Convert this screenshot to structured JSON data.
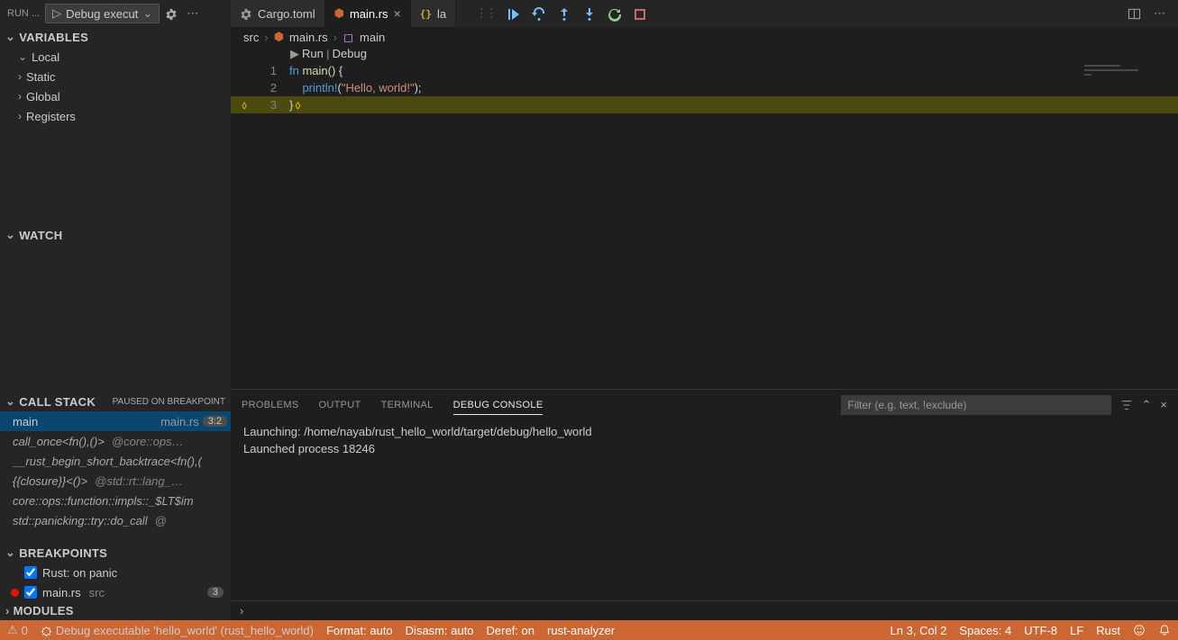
{
  "runbar": {
    "label": "RUN ...",
    "config": "Debug execut"
  },
  "tabs": [
    {
      "label": "Cargo.toml",
      "icon": "gear"
    },
    {
      "label": "main.rs",
      "icon": "rust",
      "active": true
    },
    {
      "label": "la",
      "icon": "json"
    }
  ],
  "crumbs": {
    "c0": "src",
    "c1": "main.rs",
    "c2": "main"
  },
  "codelens": {
    "run": "Run",
    "debug": "Debug"
  },
  "code": {
    "l1": {
      "num": "1",
      "kw": "fn ",
      "fn": "main",
      "rest": "() {"
    },
    "l2": {
      "num": "2",
      "m": "println!",
      "p1": "(",
      "s": "\"Hello, world!\"",
      "p2": ");"
    },
    "l3": {
      "num": "3",
      "rest": "}"
    }
  },
  "sidebar": {
    "variables": {
      "title": "VARIABLES",
      "items": [
        "Local",
        "Static",
        "Global",
        "Registers"
      ]
    },
    "watch": {
      "title": "WATCH"
    },
    "callstack": {
      "title": "CALL STACK",
      "msg": "PAUSED ON BREAKPOINT",
      "frames": [
        {
          "func": "main",
          "file": "main.rs",
          "badge": "3:2"
        },
        {
          "func": "call_once<fn(),()>",
          "loc": "@core::ops…"
        },
        {
          "func": "__rust_begin_short_backtrace<fn(),(",
          "loc": ""
        },
        {
          "func": "{{closure}}<()>",
          "loc": "@std::rt::lang_…"
        },
        {
          "func": "core::ops::function::impls::_$LT$im",
          "loc": ""
        },
        {
          "func": "std::panicking::try::do_call",
          "loc": "@"
        }
      ]
    },
    "breakpoints": {
      "title": "BREAKPOINTS",
      "items": [
        {
          "label": "Rust: on panic",
          "marker": false
        },
        {
          "label": "main.rs",
          "loc": "src",
          "badge": "3",
          "marker": true
        }
      ]
    },
    "modules": {
      "title": "MODULES"
    }
  },
  "panel": {
    "tabs": {
      "problems": "PROBLEMS",
      "output": "OUTPUT",
      "terminal": "TERMINAL",
      "debug": "DEBUG CONSOLE"
    },
    "filter_ph": "Filter (e.g. text, !exclude)",
    "lines": [
      "Launching: /home/nayab/rust_hello_world/target/debug/hello_world",
      "Launched process 18246"
    ]
  },
  "status": {
    "warn": "0",
    "debug": "Debug executable 'hello_world' (rust_hello_world)",
    "format": "Format: auto",
    "disasm": "Disasm: auto",
    "deref": "Deref: on",
    "analyzer": "rust-analyzer",
    "pos": "Ln 3, Col 2",
    "spaces": "Spaces: 4",
    "enc": "UTF-8",
    "eol": "LF",
    "lang": "Rust"
  }
}
